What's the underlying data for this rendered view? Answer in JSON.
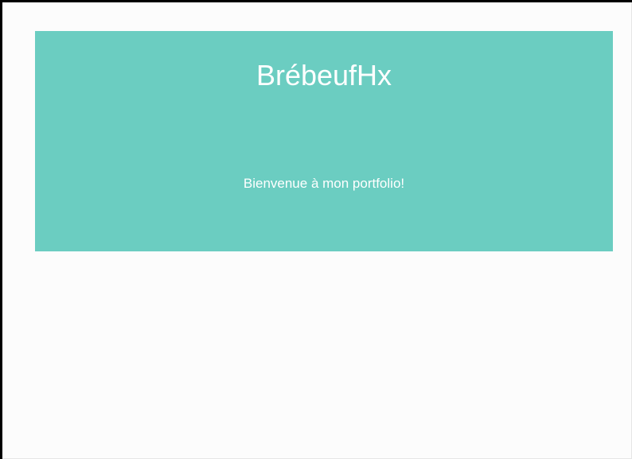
{
  "hero": {
    "title": "BrébeufHx",
    "subtitle": "Bienvenue à mon portfolio!",
    "background_color": "#6bcdc1",
    "text_color": "#ffffff"
  },
  "page": {
    "background_color": "#fcfcfc"
  }
}
